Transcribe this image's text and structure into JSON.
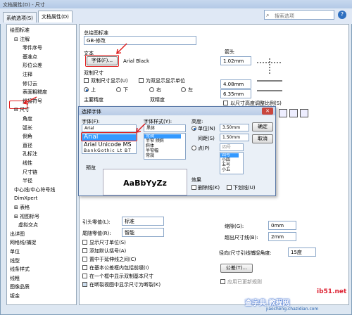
{
  "window": {
    "title": "文档属性(D) - 尺寸"
  },
  "tabs": [
    "系统选项(S)",
    "文档属性(D)"
  ],
  "search": {
    "placeholder": "搜索选项"
  },
  "tree": {
    "items": [
      {
        "label": "绘图标准",
        "indent": 0
      },
      {
        "label": "⊟ 注解",
        "indent": 1
      },
      {
        "label": "零件序号",
        "indent": 3
      },
      {
        "label": "基准点",
        "indent": 3
      },
      {
        "label": "形位公差",
        "indent": 3
      },
      {
        "label": "注释",
        "indent": 3
      },
      {
        "label": "修订云",
        "indent": 3
      },
      {
        "label": "表面粗糙度",
        "indent": 3
      },
      {
        "label": "焊接符号",
        "indent": 3
      },
      {
        "label": "⊟ 尺寸",
        "indent": 1
      },
      {
        "label": "角度",
        "indent": 3
      },
      {
        "label": "弧长",
        "indent": 3
      },
      {
        "label": "倒角",
        "indent": 3
      },
      {
        "label": "直径",
        "indent": 3
      },
      {
        "label": "孔标注",
        "indent": 3
      },
      {
        "label": "线性",
        "indent": 3
      },
      {
        "label": "尺寸链",
        "indent": 3
      },
      {
        "label": "半径",
        "indent": 3
      },
      {
        "label": "中心线/中心符号线",
        "indent": 1
      },
      {
        "label": "DimXpert",
        "indent": 1
      },
      {
        "label": "⊞ 表格",
        "indent": 1
      },
      {
        "label": "⊞ 视图标号",
        "indent": 1
      },
      {
        "label": "虚拟交点",
        "indent": 2
      },
      {
        "label": "出详图",
        "indent": 0
      },
      {
        "label": "网格线/捕捉",
        "indent": 0
      },
      {
        "label": "单位",
        "indent": 0
      },
      {
        "label": "线型",
        "indent": 0
      },
      {
        "label": "线条样式",
        "indent": 0
      },
      {
        "label": "线粗",
        "indent": 0
      },
      {
        "label": "图像品质",
        "indent": 0
      },
      {
        "label": "钣金",
        "indent": 0
      }
    ]
  },
  "main": {
    "standard_label": "总绘图标准",
    "standard_value": "GB-修改",
    "text_label": "文本",
    "font_button": "字体(F)...",
    "font_value": "Arial Black",
    "dual_label": "双制尺寸",
    "dual_show": "双制尺寸显示(U)",
    "dual_unit": "为双显示显示单位",
    "pos_top": "上",
    "pos_bottom": "下",
    "pos_right": "右",
    "pos_left": "左",
    "primary_label": "主要精度",
    "dual_precision_label": "双精度",
    "arrow_label": "箭头",
    "arrow_values": [
      "1.02mm",
      "4.08mm",
      "6.35mm"
    ],
    "scale_label": "以尺寸高度调整比例(S)",
    "lead_zero_label": "引头零值(L):",
    "lead_zero_value": "标准",
    "trail_zero_label": "尾随零值(R):",
    "trail_zero_value": "智能",
    "checks": [
      "显示尺寸单位(S)",
      "添加默认括号(A)",
      "置中于延伸线之间(C)",
      "在基本公差框内包括前缀(I)",
      "在一个框中显示双制基本尺寸",
      "在断裂视图中显示尺寸为断裂(K)"
    ],
    "gap_label": "缩隙(G):",
    "gap_value": "0mm",
    "extend_label": "超出尺寸线(B):",
    "extend_value": "2mm",
    "radial_label": "径向/尺寸引线捕捉角度:",
    "radial_value": "15度",
    "tol_button": "公差(T)...",
    "apply_update": "应用已更新规则"
  },
  "font_dialog": {
    "title": "选择字体",
    "font_label": "字体(F):",
    "font_input": "Arial",
    "font_list": [
      "Arial",
      "Arial Unicode MS",
      "BankGothic Lt BT"
    ],
    "style_label": "字体样式(Y):",
    "style_input": "黑体",
    "style_list": [
      "常规",
      "半窄 倾斜",
      "斜体",
      "半窄幅",
      "常规"
    ],
    "height_label": "高度:",
    "unit_label": "单位(N)",
    "unit_value": "3.50mm",
    "spacing_label": "间距(S)",
    "spacing_value": "1.50mm",
    "point_label": "点(P)",
    "point_input": "四号",
    "point_list": [
      "四号",
      "小四",
      "五号",
      "小五"
    ],
    "ok": "确定",
    "cancel": "取消",
    "preview_label": "预览",
    "preview_text": "AaBbYyZz",
    "effects_label": "效果",
    "strike_label": "删除线(K)",
    "underline_label": "下划线(U)"
  },
  "watermark": {
    "line1": "ib51.net",
    "line2": "查字典 教程网",
    "line3": "jiaocheng.chazidian.com"
  }
}
